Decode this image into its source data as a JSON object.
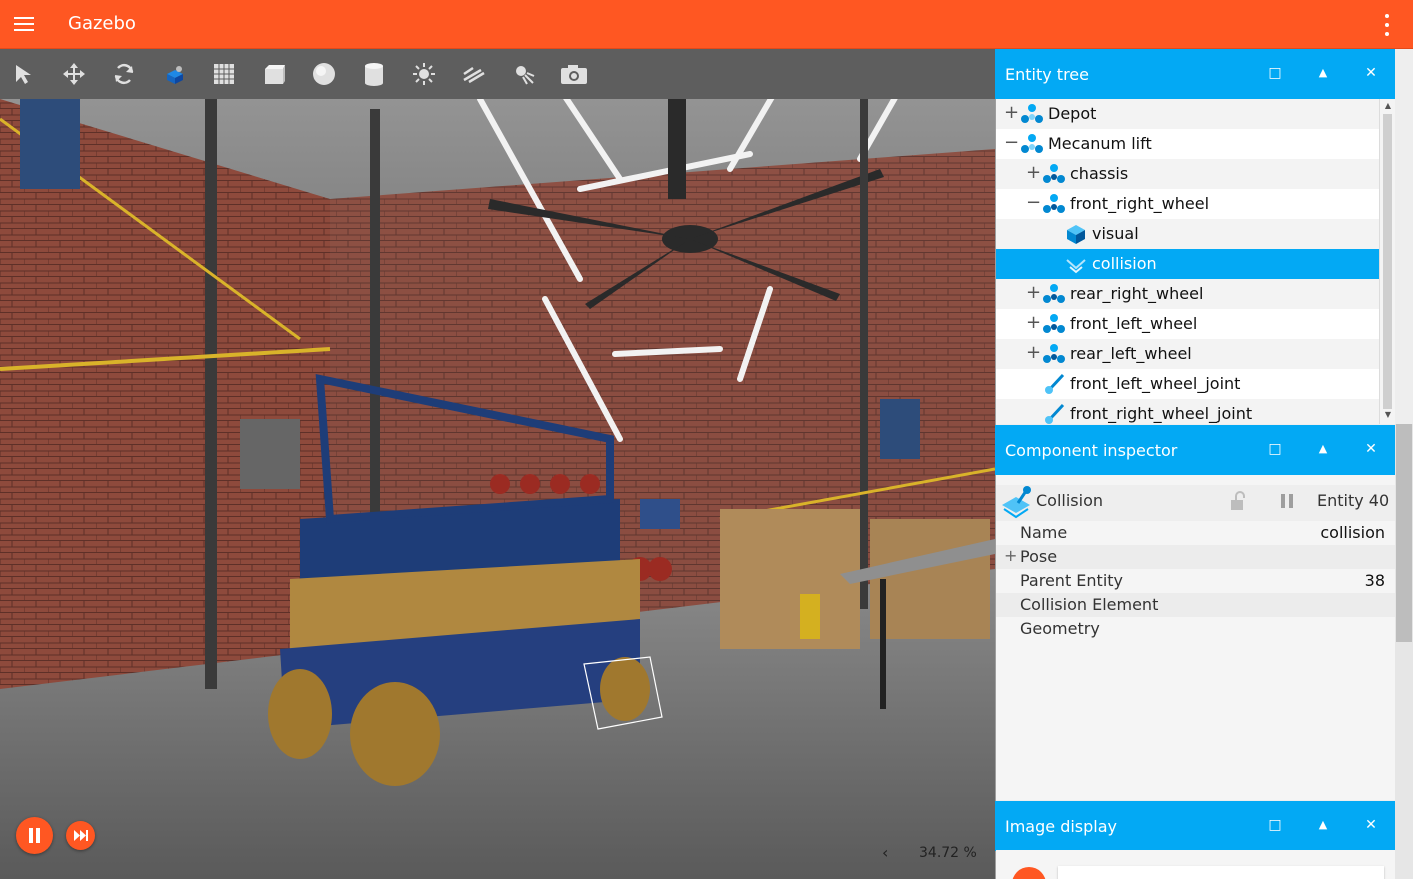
{
  "window": {
    "title": "Gazebo"
  },
  "toolbar": {
    "tools": [
      "select-icon",
      "translate-icon",
      "rotate-icon",
      "transform-control-icon",
      "grid-icon",
      "box-icon",
      "sphere-icon",
      "cylinder-icon",
      "sun-icon",
      "directional-light-icon",
      "point-light-icon",
      "camera-icon"
    ]
  },
  "playback": {
    "state": "playing",
    "rtf": "34.72 %",
    "chevron": "‹"
  },
  "entity_tree": {
    "title": "Entity tree",
    "rows": [
      {
        "label": "Depot",
        "expander": "+",
        "icon": "model-icon"
      },
      {
        "label": "Mecanum lift",
        "expander": "−",
        "icon": "model-icon"
      },
      {
        "label": "chassis",
        "expander": "+",
        "icon": "link-icon"
      },
      {
        "label": "front_right_wheel",
        "expander": "−",
        "icon": "link-icon"
      },
      {
        "label": "visual",
        "expander": "",
        "icon": "visual-icon"
      },
      {
        "label": "collision",
        "expander": "",
        "icon": "collision-icon",
        "selected": true
      },
      {
        "label": "rear_right_wheel",
        "expander": "+",
        "icon": "link-icon"
      },
      {
        "label": "front_left_wheel",
        "expander": "+",
        "icon": "link-icon"
      },
      {
        "label": "rear_left_wheel",
        "expander": "+",
        "icon": "link-icon"
      },
      {
        "label": "front_left_wheel_joint",
        "expander": "",
        "icon": "joint-icon"
      },
      {
        "label": "front_right_wheel_joint",
        "expander": "",
        "icon": "joint-icon"
      }
    ]
  },
  "component_inspector": {
    "title": "Component inspector",
    "entity_type": "Collision",
    "entity_id": "Entity 40",
    "rows": [
      {
        "key": "Name",
        "value": "collision",
        "expander": ""
      },
      {
        "key": "Pose",
        "value": "",
        "expander": "+"
      },
      {
        "key": "Parent Entity",
        "value": "38",
        "expander": ""
      },
      {
        "key": "Collision Element",
        "value": "",
        "expander": ""
      },
      {
        "key": "Geometry",
        "value": "",
        "expander": ""
      }
    ]
  },
  "image_display": {
    "title": "Image display"
  },
  "panel_buttons": {
    "float": "□",
    "collapse": "▲",
    "close": "✕"
  },
  "colors": {
    "accent": "#ff5722",
    "panel_header": "#03a9f4",
    "selection": "#03a9f4"
  }
}
